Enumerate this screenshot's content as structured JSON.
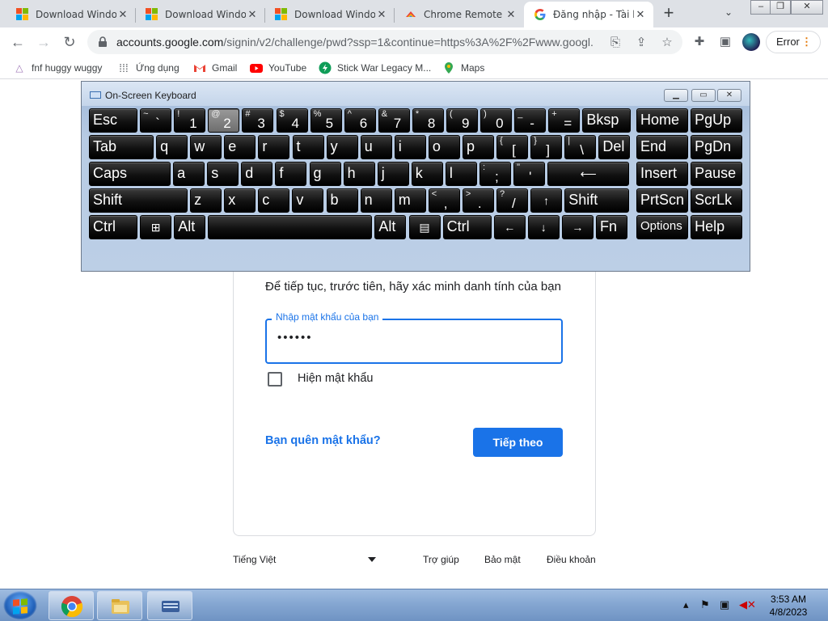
{
  "browser": {
    "tabs": [
      {
        "title": "Download Windo",
        "favicon": "windows-logo-icon"
      },
      {
        "title": "Download Windo",
        "favicon": "windows-logo-icon"
      },
      {
        "title": "Download Windo",
        "favicon": "windows-logo-icon"
      },
      {
        "title": "Chrome Remote D",
        "favicon": "chrome-remote-desktop-icon"
      },
      {
        "title": "Đăng nhập - Tài k",
        "favicon": "google-g-icon",
        "active": true
      }
    ],
    "window_buttons": [
      "–",
      "❐",
      "✕"
    ],
    "url_host": "accounts.google.com",
    "url_rest": "/signin/v2/challenge/pwd?ssp=1&continue=https%3A%2F%2Fwww.googl...",
    "error_label": "Error"
  },
  "bookmarks": [
    {
      "label": "fnf huggy wuggy",
      "icon": "triangle-icon"
    },
    {
      "label": "Ứng dụng",
      "icon": "apps-grid-icon"
    },
    {
      "label": "Gmail",
      "icon": "gmail-icon"
    },
    {
      "label": "YouTube",
      "icon": "youtube-icon"
    },
    {
      "label": "Stick War Legacy M...",
      "icon": "bolt-icon"
    },
    {
      "label": "Maps",
      "icon": "maps-pin-icon"
    }
  ],
  "signin": {
    "subtitle": "Để tiếp tục, trước tiên, hãy xác minh danh tính của bạn",
    "password_label": "Nhập mật khẩu của bạn",
    "password_value": "••••••",
    "show_password": "Hiện mật khẩu",
    "forgot": "Bạn quên mật khẩu?",
    "next": "Tiếp theo"
  },
  "footer": {
    "language": "Tiếng Việt",
    "help": "Trợ giúp",
    "privacy": "Bảo mật",
    "terms": "Điều khoản"
  },
  "osk": {
    "title": "On-Screen Keyboard",
    "rows": [
      [
        [
          "Esc",
          ""
        ],
        [
          "`",
          "~"
        ],
        [
          "1",
          "!"
        ],
        [
          "2",
          "@"
        ],
        [
          "3",
          "#"
        ],
        [
          "4",
          "$"
        ],
        [
          "5",
          "%"
        ],
        [
          "6",
          "^"
        ],
        [
          "7",
          "&"
        ],
        [
          "8",
          "*"
        ],
        [
          "9",
          "("
        ],
        [
          "0",
          ")"
        ],
        [
          "-",
          "_"
        ],
        [
          "=",
          "+"
        ],
        [
          "Bksp",
          ""
        ],
        [
          "Home",
          ""
        ],
        [
          "PgUp",
          ""
        ]
      ],
      [
        [
          "Tab",
          ""
        ],
        [
          "q",
          ""
        ],
        [
          "w",
          ""
        ],
        [
          "e",
          ""
        ],
        [
          "r",
          ""
        ],
        [
          "t",
          ""
        ],
        [
          "y",
          ""
        ],
        [
          "u",
          ""
        ],
        [
          "i",
          ""
        ],
        [
          "o",
          ""
        ],
        [
          "p",
          ""
        ],
        [
          "[",
          "{"
        ],
        [
          "]",
          "}"
        ],
        [
          "\\",
          "|"
        ],
        [
          "Del",
          ""
        ],
        [
          "End",
          ""
        ],
        [
          "PgDn",
          ""
        ]
      ],
      [
        [
          "Caps",
          ""
        ],
        [
          "a",
          ""
        ],
        [
          "s",
          ""
        ],
        [
          "d",
          ""
        ],
        [
          "f",
          ""
        ],
        [
          "g",
          ""
        ],
        [
          "h",
          ""
        ],
        [
          "j",
          ""
        ],
        [
          "k",
          ""
        ],
        [
          "l",
          ""
        ],
        [
          ";",
          ":"
        ],
        [
          "'",
          "\""
        ],
        [
          "⟵",
          ""
        ],
        [
          "Insert",
          ""
        ],
        [
          "Pause",
          ""
        ]
      ],
      [
        [
          "Shift",
          ""
        ],
        [
          "z",
          ""
        ],
        [
          "x",
          ""
        ],
        [
          "c",
          ""
        ],
        [
          "v",
          ""
        ],
        [
          "b",
          ""
        ],
        [
          "n",
          ""
        ],
        [
          "m",
          ""
        ],
        [
          ",",
          "<"
        ],
        [
          ".",
          ">"
        ],
        [
          "/",
          "?"
        ],
        [
          "↑",
          ""
        ],
        [
          "Shift",
          ""
        ],
        [
          "PrtScn",
          ""
        ],
        [
          "ScrLk",
          ""
        ]
      ],
      [
        [
          "Ctrl",
          ""
        ],
        [
          "⊞",
          ""
        ],
        [
          "Alt",
          ""
        ],
        [
          "",
          ""
        ],
        [
          "Alt",
          ""
        ],
        [
          "▤",
          ""
        ],
        [
          "Ctrl",
          ""
        ],
        [
          "←",
          ""
        ],
        [
          "↓",
          ""
        ],
        [
          "→",
          ""
        ],
        [
          "Fn",
          ""
        ],
        [
          "Options",
          ""
        ],
        [
          "Help",
          ""
        ]
      ]
    ],
    "pressed_key": "2"
  },
  "taskbar": {
    "time": "3:53 AM",
    "date": "4/8/2023",
    "apps": [
      "chrome-icon",
      "file-explorer-icon",
      "on-screen-keyboard-icon"
    ]
  }
}
